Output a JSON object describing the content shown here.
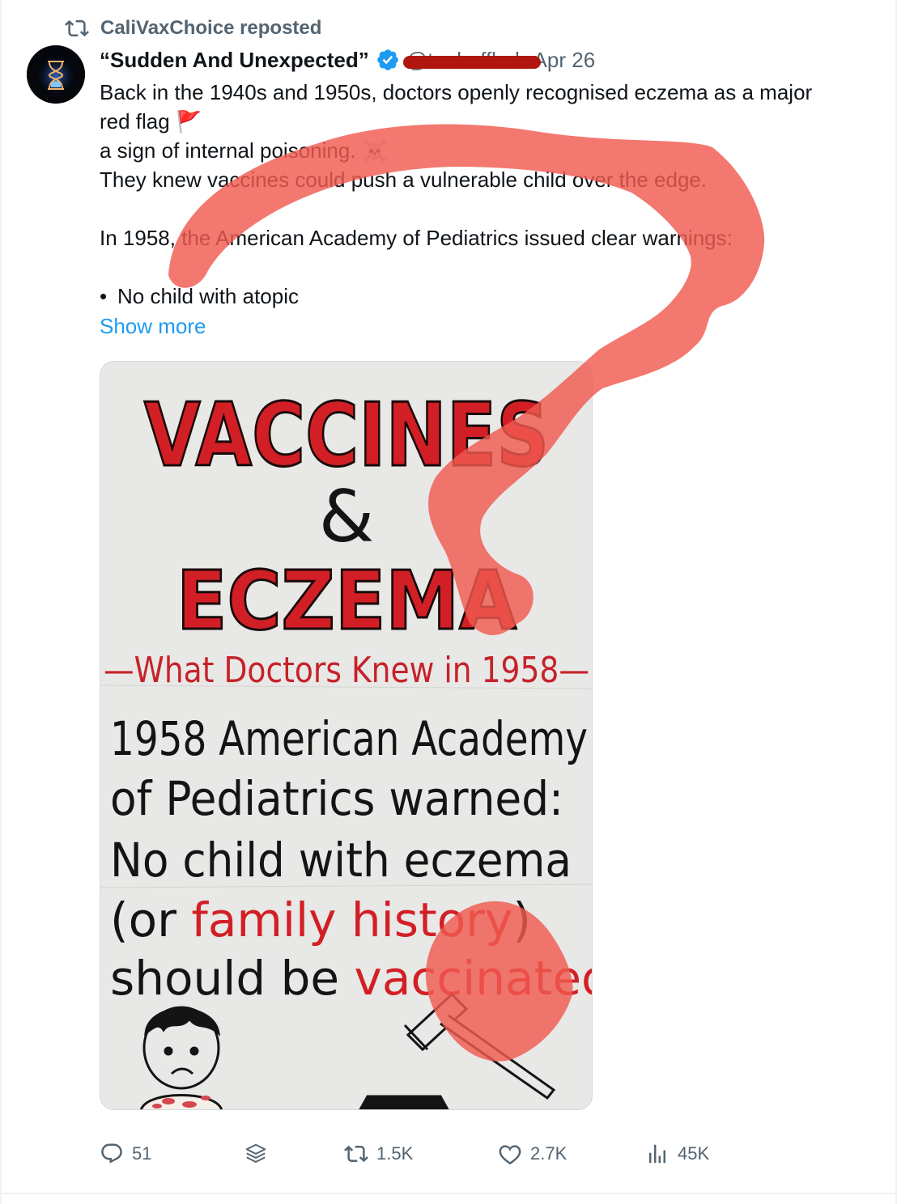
{
  "repost": {
    "label": "CaliVaxChoice reposted"
  },
  "author": {
    "display_name": "“Sudden And Unexpected”",
    "verified": true,
    "handle": "@toobaffled",
    "separator": "·",
    "date": "Apr 26"
  },
  "post": {
    "lines": [
      "Back in the 1940s and 1950s, doctors openly recognised eczema as a major",
      "red flag 🚩",
      "a sign of internal poisoning. ☠️",
      "They knew vaccines could push a vulnerable child over the edge.",
      "In 1958, the American Academy of Pediatrics issued clear warnings:",
      "No child with atopic"
    ],
    "bullet": "•",
    "show_more": "Show more"
  },
  "image": {
    "title_line1": "VACCINES",
    "ampersand": "&",
    "title_line2": "ECZEMA",
    "subtitle": "—What Doctors Knew in 1958—",
    "body_line1": "1958 American Academy",
    "body_line2": "of Pediatrics warned:",
    "body_line3": "No child with eczema",
    "body_line4_a": "(or ",
    "body_line4_b": "family history",
    "body_line4_c": ")",
    "body_line5_a": "should be ",
    "body_line5_b": "vaccinated",
    "colors": {
      "red": "#d21f26",
      "ink": "#141414",
      "board": "#e8e8e6"
    }
  },
  "actions": {
    "replies": "51",
    "reposts": "1.5K",
    "likes": "2.7K",
    "views": "45K",
    "icons": [
      "reply-icon",
      "layers-icon",
      "repost-icon",
      "like-icon",
      "views-icon"
    ]
  },
  "overlay": {
    "color": "#f05a4f",
    "shape": "question-mark"
  }
}
